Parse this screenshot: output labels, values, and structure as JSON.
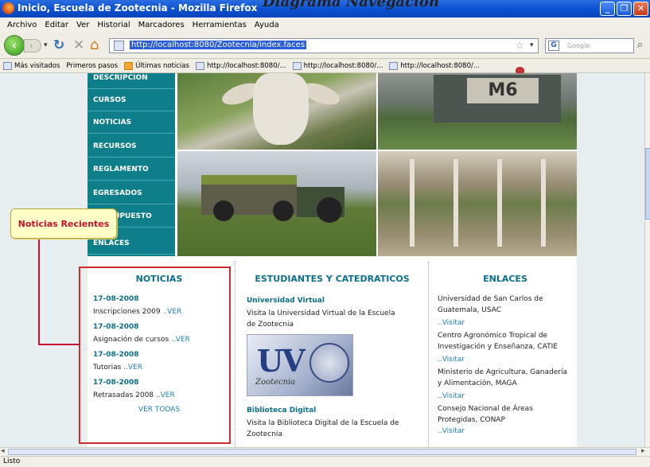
{
  "window": {
    "title": "Inicio, Escuela de Zootecnia - Mozilla Firefox",
    "annotation": "Diagrama Navegación"
  },
  "menubar": [
    "Archivo",
    "Editar",
    "Ver",
    "Historial",
    "Marcadores",
    "Herramientas",
    "Ayuda"
  ],
  "navbar": {
    "url": "http://localhost:8080/Zootecnia/index.faces",
    "search_placeholder": "Google"
  },
  "bookmarks": [
    {
      "label": "Más visitados",
      "icon": "folder-icon"
    },
    {
      "label": "Primeros pasos",
      "icon": "firefox-icon"
    },
    {
      "label": "Últimas noticias",
      "icon": "rss-icon"
    },
    {
      "label": "http://localhost:8080/...",
      "icon": "page-icon"
    },
    {
      "label": "http://localhost:8080/...",
      "icon": "page-icon"
    },
    {
      "label": "http://localhost:8080/...",
      "icon": "page-icon"
    }
  ],
  "sidenav": [
    "DESCRIPCION",
    "CURSOS",
    "NOTICIAS",
    "RECURSOS",
    "REGLAMENTO",
    "EGRESADOS",
    "PRESUPUESTO",
    "ENLACES"
  ],
  "callout": "Noticias Recientes",
  "noticias": {
    "heading": "NOTICIAS",
    "items": [
      {
        "date": "17-08-2008",
        "text": "Inscripciones 2009",
        "link": "..VER"
      },
      {
        "date": "17-08-2008",
        "text": "Asignación de cursos",
        "link": "..VER"
      },
      {
        "date": "17-08-2008",
        "text": "Tutorias",
        "link": "..VER"
      },
      {
        "date": "17-08-2008",
        "text": "Retrasadas 2008",
        "link": "..VER"
      }
    ],
    "all_link": "VER TODAS"
  },
  "estudiantes": {
    "heading": "ESTUDIANTES Y CATEDRATICOS",
    "virtual_title": "Universidad Virtual",
    "virtual_text": "Visita la Universidad Virtual de la Escuela de Zootecnia",
    "logo_text": "UV",
    "logo_sub": "Zootecnia",
    "digital_title": "Biblioteca Digital",
    "digital_text": "Visita la Biblioteca Digital de la Escuela de Zootecnia"
  },
  "enlaces": {
    "heading": "ENLACES",
    "items": [
      {
        "text": "Universidad de San Carlos de Guatemala, USAC",
        "link": "..Visitar"
      },
      {
        "text": "Centro Agronómico Tropical de Investigación y Enseñanza, CATIE",
        "link": "..Visitar"
      },
      {
        "text": "Ministerio de Agricultura, Ganadería y Alimentación, MAGA",
        "link": "..Visitar"
      },
      {
        "text": "Consejo Nacional de Áreas Protegidas, CONAP",
        "link": "..Visitar"
      }
    ]
  },
  "photo_sign": "M6",
  "status": "Listo"
}
